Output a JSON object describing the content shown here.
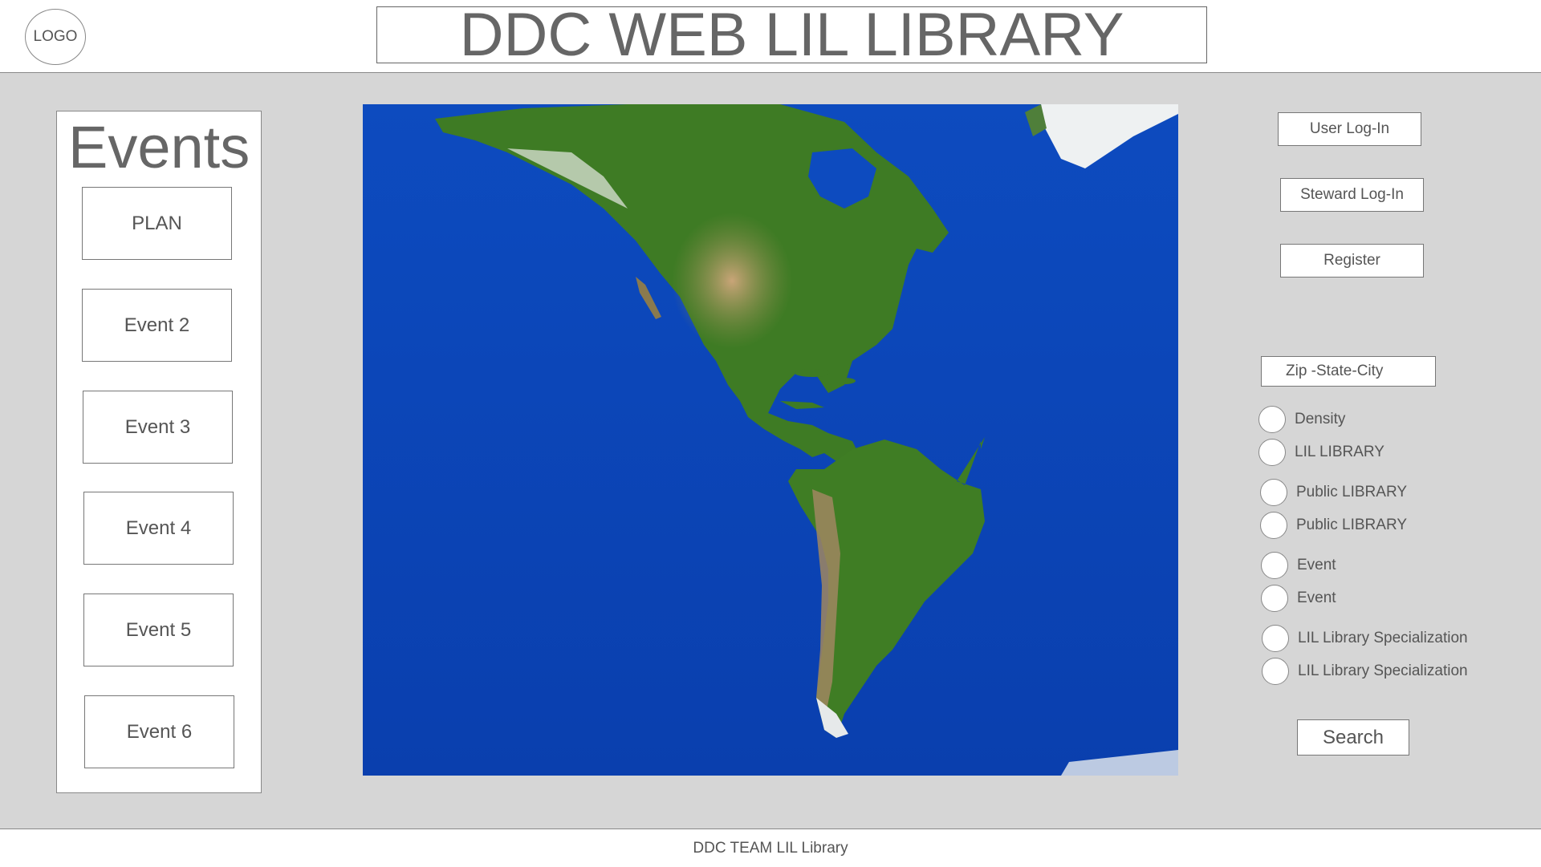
{
  "header": {
    "logo_label": "LOGO",
    "title": "DDC WEB LIL LIBRARY"
  },
  "events": {
    "title": "Events",
    "items": [
      "PLAN",
      "Event 2",
      "Event 3",
      "Event 4",
      "Event 5",
      "Event 6"
    ]
  },
  "map": {
    "region": "Americas satellite map",
    "colors": {
      "ocean": "#0a45b8",
      "land": "#3f7d24",
      "ice": "#f2f4f5"
    }
  },
  "account": {
    "user_login": "User Log-In",
    "steward_login": "Steward Log-In",
    "register": "Register"
  },
  "filters": {
    "location_placeholder": "Zip -State-City",
    "options": [
      "Density",
      "LIL LIBRARY",
      "Public LIBRARY",
      "Public LIBRARY",
      "Event",
      "Event",
      "LIL Library Specialization",
      "LIL Library Specialization"
    ],
    "search_label": "Search"
  },
  "footer": {
    "text": "DDC TEAM LIL Library"
  },
  "colors": {
    "background": "#d6d6d6",
    "panel": "#ffffff",
    "border": "#888888",
    "text": "#555555"
  }
}
